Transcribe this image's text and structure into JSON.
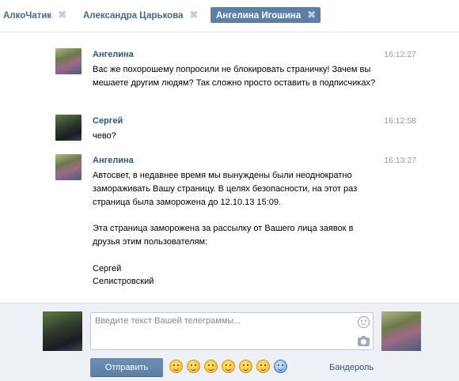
{
  "tabs": [
    {
      "label": "АлкоЧатик",
      "active": false
    },
    {
      "label": "Александра Царькова",
      "active": false
    },
    {
      "label": "Ангелина Игошина",
      "active": true
    }
  ],
  "messages": [
    {
      "author": "Ангелина",
      "time": "16:12:27",
      "lines": [
        "Вас же похорошему попросили не блокировать страничку! Зачем вы мешаете другим людям? Так сложно просто оставить в подписчиках?"
      ]
    },
    {
      "author": "Сергей",
      "time": "16:12:58",
      "lines": [
        "чево?"
      ]
    },
    {
      "author": "Ангелина",
      "time": "16:13:27",
      "lines": [
        "Автосвет, в недавнее время мы вынуждены были неоднократно замораживать Вашу страницу. В целях безопасности, на этот раз страница была заморожена до 12.10.13 15:09.",
        "",
        "Эта страница заморожена за рассылку от Вашего лица заявок в друзья этим пользователям:",
        "",
        "Сергей",
        "Селистровский"
      ]
    }
  ],
  "composer": {
    "placeholder": "Введите текст Вашей телеграммы...",
    "send_label": "Отправить",
    "parcel_label": "Бандероль",
    "emoji_icons": [
      "laughing-emoji-icon",
      "grin-emoji-icon",
      "kiss-emoji-icon",
      "smile-emoji-icon",
      "shock-emoji-icon",
      "worried-emoji-icon",
      "fear-emoji-icon"
    ]
  },
  "colors": {
    "accent": "#5b7fa6",
    "link": "#2b587a",
    "composer_bg": "#edf1f5"
  }
}
